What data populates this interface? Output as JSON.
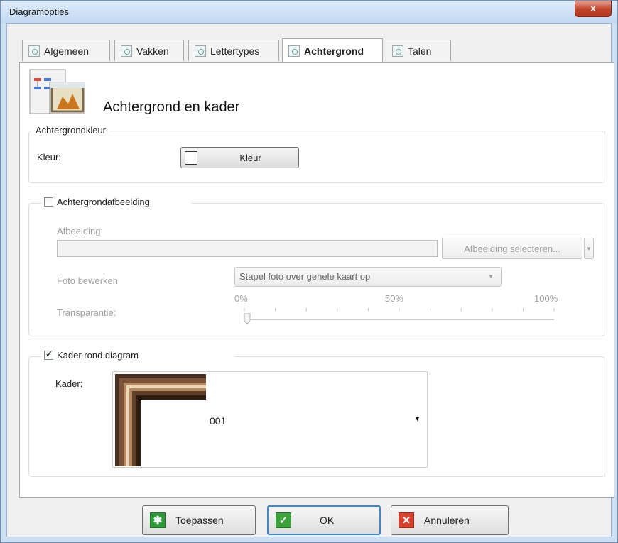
{
  "window": {
    "title": "Diagramopties",
    "close_glyph": "x"
  },
  "tabs": [
    {
      "label": "Algemeen",
      "icon": "settings-page-icon",
      "active": false
    },
    {
      "label": "Vakken",
      "icon": "settings-page-icon",
      "active": false
    },
    {
      "label": "Lettertypes",
      "icon": "settings-page-icon",
      "active": false
    },
    {
      "label": "Achtergrond",
      "icon": "settings-page-icon",
      "active": true
    },
    {
      "label": "Talen",
      "icon": "settings-page-icon",
      "active": false
    }
  ],
  "header": {
    "title": "Achtergrond en kader",
    "icon": "background-frame-icon"
  },
  "background_color": {
    "legend": "Achtergrondkleur",
    "color_label": "Kleur:",
    "color_button_label": "Kleur"
  },
  "background_image": {
    "legend": "Achtergrondafbeelding",
    "checked": false,
    "image_label": "Afbeelding:",
    "image_value": "",
    "select_button_label": "Afbeelding selecteren...",
    "photo_edit_label": "Foto bewerken",
    "photo_edit_value": "Stapel foto over gehele kaart op",
    "transparency_label": "Transparantie:",
    "slider_ticks": [
      "0%",
      "50%",
      "100%"
    ],
    "slider_value_percent": 0
  },
  "frame": {
    "legend": "Kader rond diagram",
    "checked": true,
    "frame_label": "Kader:",
    "frame_value": "001"
  },
  "buttons": {
    "apply": "Toepassen",
    "ok": "OK",
    "cancel": "Annuleren"
  },
  "colors": {
    "frame_brown": "#6b4a34",
    "ok_green": "#3aa33a",
    "cancel_red": "#d9412b"
  }
}
